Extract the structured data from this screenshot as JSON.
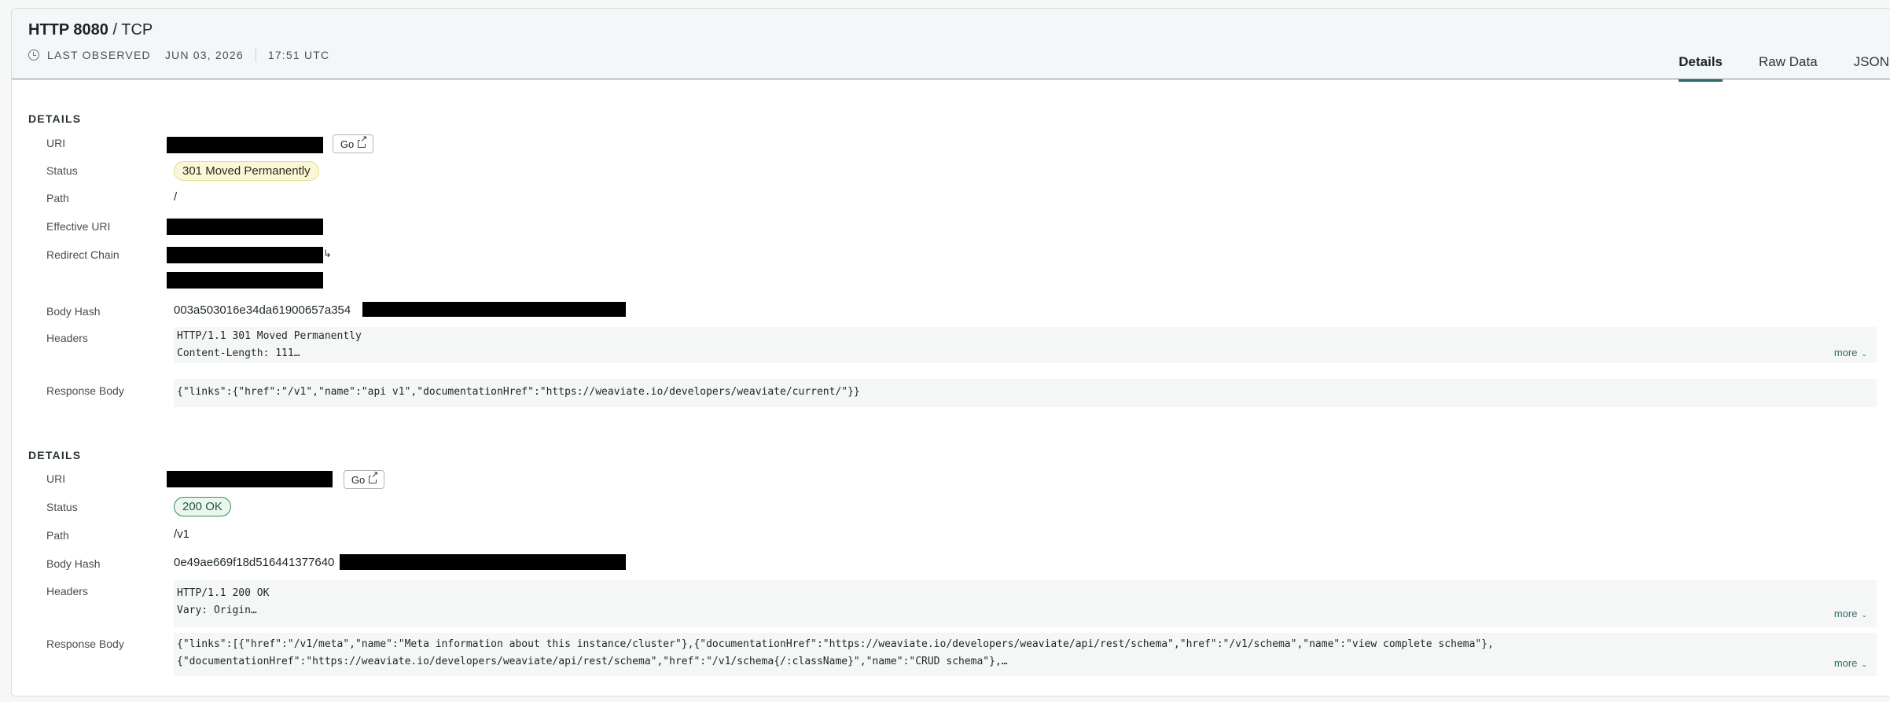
{
  "header": {
    "protocol": "HTTP",
    "port": "8080",
    "separator": "/",
    "transport": "TCP",
    "last_observed_label": "LAST OBSERVED",
    "date": "JUN 03, 2026",
    "time": "17:51 UTC"
  },
  "tabs": [
    {
      "label": "Details",
      "active": true
    },
    {
      "label": "Raw Data",
      "active": false
    },
    {
      "label": "JSON",
      "active": false
    }
  ],
  "sections": [
    {
      "title": "DETAILS",
      "labels": {
        "uri": "URI",
        "status": "Status",
        "path": "Path",
        "effective_uri": "Effective URI",
        "redirect_chain": "Redirect Chain",
        "body_hash": "Body Hash",
        "headers": "Headers",
        "response_body": "Response Body"
      },
      "go_label": "Go",
      "status": "301 Moved Permanently",
      "path": "/",
      "body_hash": "003a503016e34da61900657a354",
      "headers": [
        "HTTP/1.1 301 Moved Permanently",
        "Content-Length: 111…"
      ],
      "more_label": "more",
      "response_body": "{\"links\":{\"href\":\"/v1\",\"name\":\"api v1\",\"documentationHref\":\"https://weaviate.io/developers/weaviate/current/\"}}"
    },
    {
      "title": "DETAILS",
      "labels": {
        "uri": "URI",
        "status": "Status",
        "path": "Path",
        "body_hash": "Body Hash",
        "headers": "Headers",
        "response_body": "Response Body"
      },
      "go_label": "Go",
      "status": "200 OK",
      "path": "/v1",
      "body_hash": "0e49ae669f18d516441377640",
      "headers": [
        "HTTP/1.1 200 OK",
        "Vary: Origin…"
      ],
      "more_label": "more",
      "response_body_lines": [
        "{\"links\":[{\"href\":\"/v1/meta\",\"name\":\"Meta information about this instance/cluster\"},{\"documentationHref\":\"https://weaviate.io/developers/weaviate/api/rest/schema\",\"href\":\"/v1/schema\",\"name\":\"view complete schema\"},",
        "{\"documentationHref\":\"https://weaviate.io/developers/weaviate/api/rest/schema\",\"href\":\"/v1/schema{/:className}\",\"name\":\"CRUD schema\"},…"
      ]
    }
  ],
  "colors": {
    "accent": "#2f6d6a",
    "warn_badge_bg": "#fbf6d8",
    "ok_badge_border": "#3b8a5a",
    "redaction": "#000000"
  },
  "icons": {
    "clock": "clock-icon",
    "external_link": "external-link-icon",
    "chevron": "chevron-down-icon",
    "redirect_arrow": "arrow-down-icon"
  }
}
